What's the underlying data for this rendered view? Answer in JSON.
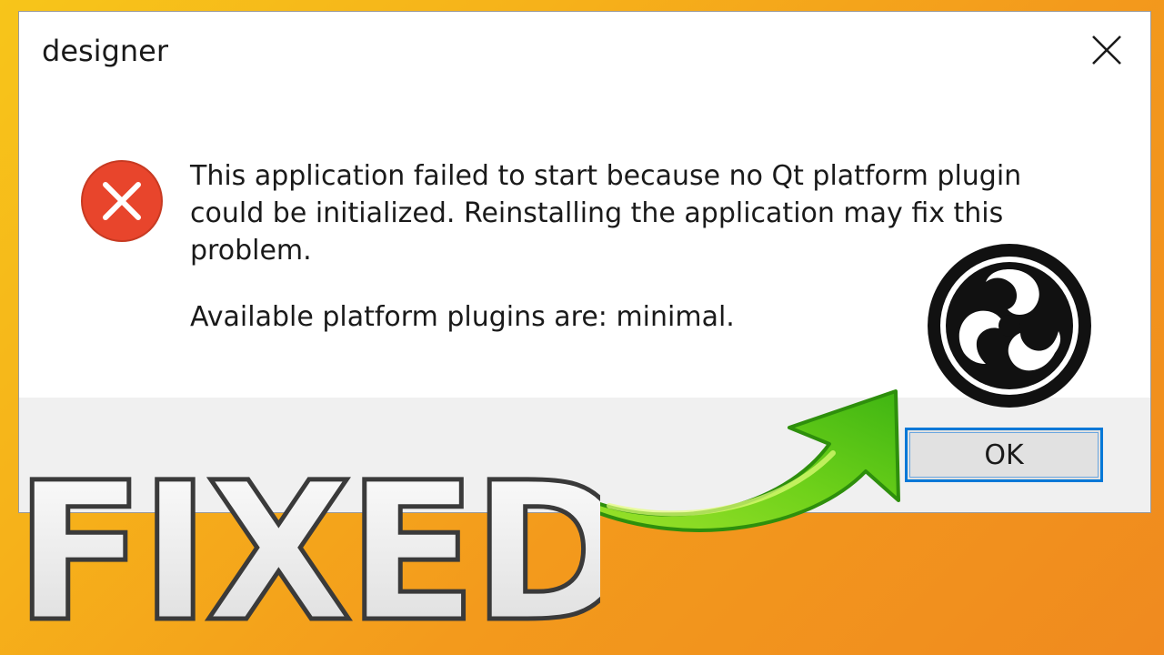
{
  "window": {
    "title": "designer",
    "close_icon": "close-icon"
  },
  "message": {
    "icon": "error-icon",
    "lines": [
      "This application failed to start because no Qt platform plugin",
      "could be initialized. Reinstalling the application may fix this",
      "problem."
    ],
    "plugins_line": "Available platform plugins are: minimal."
  },
  "buttons": {
    "ok_label": "OK"
  },
  "overlay": {
    "caption": "FIXED",
    "logo": "obs-logo",
    "arrow": "green-arrow-icon"
  },
  "colors": {
    "background": "#f6b21a",
    "error_red": "#e8452c",
    "button_focus": "#0078d7",
    "arrow_green": "#6fd11a"
  }
}
